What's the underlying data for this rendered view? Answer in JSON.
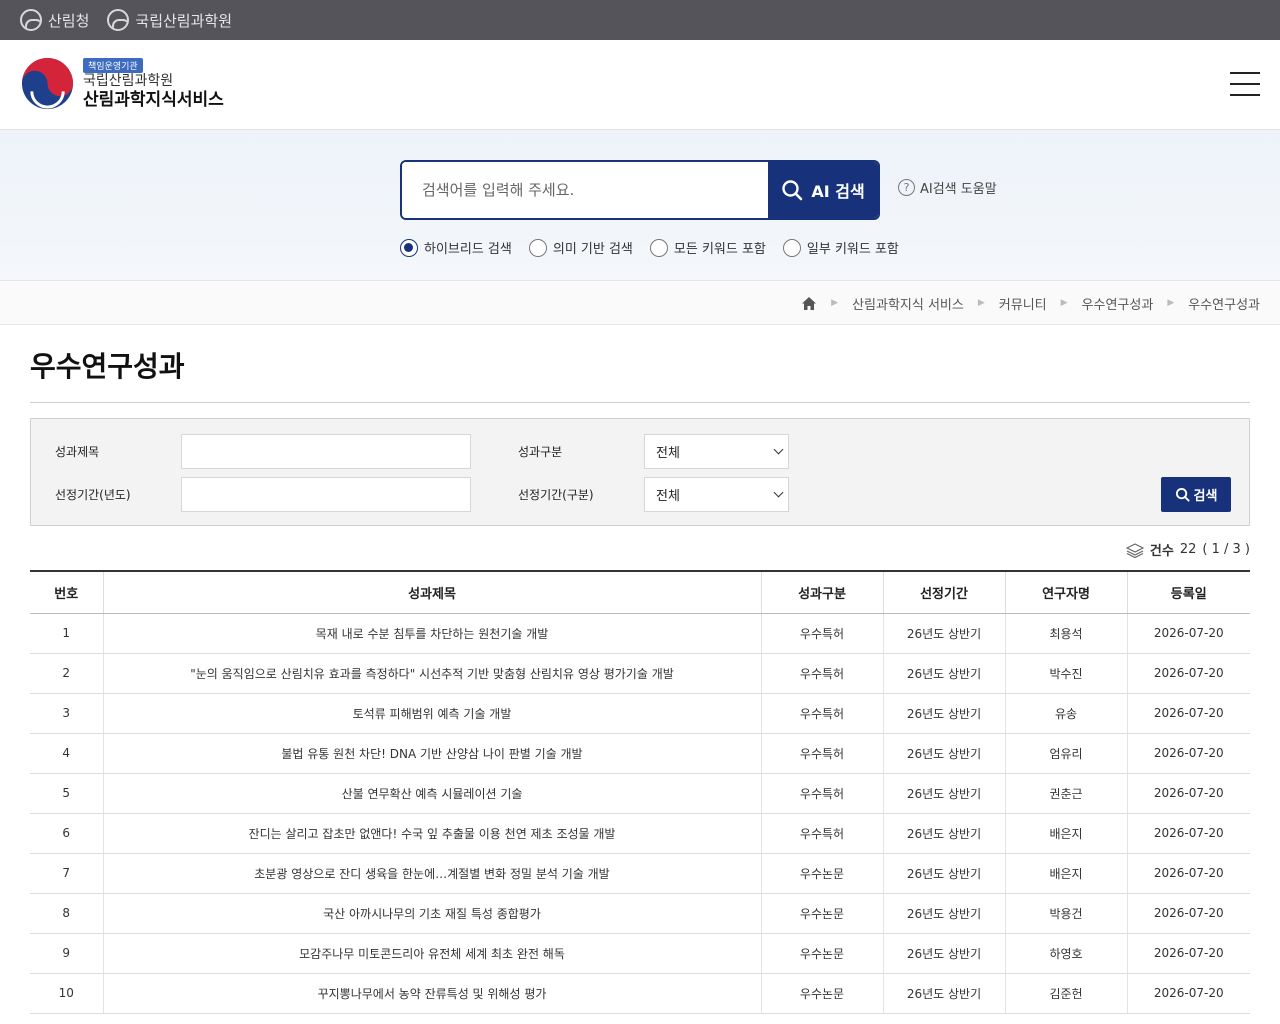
{
  "topbar": {
    "links": [
      "산림청",
      "국립산림과학원"
    ]
  },
  "header": {
    "badge": "책임운영기관",
    "org_sub": "국립산림과학원",
    "org_main": "산림과학지식서비스"
  },
  "search": {
    "placeholder": "검색어를 입력해 주세요.",
    "button_label": "AI 검색",
    "help_label": "AI검색 도움말",
    "modes": [
      "하이브리드 검색",
      "의미 기반 검색",
      "모든 키워드 포함",
      "일부 키워드 포함"
    ],
    "selected_mode": 0
  },
  "breadcrumb": [
    "산림과학지식 서비스",
    "커뮤니티",
    "우수연구성과",
    "우수연구성과"
  ],
  "page_title": "우수연구성과",
  "filter": {
    "title_label": "성과제목",
    "category_label": "성과구분",
    "category_value": "전체",
    "year_label": "선정기간(년도)",
    "period_label": "선정기간(구분)",
    "period_value": "전체",
    "search_button": "검색"
  },
  "count": {
    "label": "건수",
    "total": "22",
    "pages": "( 1 / 3 )"
  },
  "table": {
    "headers": [
      "번호",
      "성과제목",
      "성과구분",
      "선정기간",
      "연구자명",
      "등록일"
    ],
    "rows": [
      [
        "1",
        "목재 내로 수분 침투를 차단하는 원천기술 개발",
        "우수특허",
        "26년도 상반기",
        "최용석",
        "2026-07-20"
      ],
      [
        "2",
        "\"눈의 움직임으로 산림치유 효과를 측정하다\" 시선추적 기반 맞춤형 산림치유 영상 평가기술 개발",
        "우수특허",
        "26년도 상반기",
        "박수진",
        "2026-07-20"
      ],
      [
        "3",
        "토석류 피해범위 예측 기술 개발",
        "우수특허",
        "26년도 상반기",
        "유송",
        "2026-07-20"
      ],
      [
        "4",
        "불법 유통 원천 차단! DNA 기반 산양삼 나이 판별 기술 개발",
        "우수특허",
        "26년도 상반기",
        "엄유리",
        "2026-07-20"
      ],
      [
        "5",
        "산불 연무확산 예측 시뮬레이션 기술",
        "우수특허",
        "26년도 상반기",
        "권춘근",
        "2026-07-20"
      ],
      [
        "6",
        "잔디는 살리고 잡초만 없앤다! 수국 잎 추출물 이용 천연 제초 조성물 개발",
        "우수특허",
        "26년도 상반기",
        "배은지",
        "2026-07-20"
      ],
      [
        "7",
        "초분광 영상으로 잔디 생육을 한눈에…계절별 변화 정밀 분석 기술 개발",
        "우수논문",
        "26년도 상반기",
        "배은지",
        "2026-07-20"
      ],
      [
        "8",
        "국산 아까시나무의 기초 재질 특성 종합평가",
        "우수논문",
        "26년도 상반기",
        "박용건",
        "2026-07-20"
      ],
      [
        "9",
        "모감주나무 미토콘드리아 유전체 세계 최초 완전 해독",
        "우수논문",
        "26년도 상반기",
        "하영호",
        "2026-07-20"
      ],
      [
        "10",
        "꾸지뽕나무에서 농약 잔류특성 및 위해성 평가",
        "우수논문",
        "26년도 상반기",
        "김준헌",
        "2026-07-20"
      ]
    ]
  },
  "colors": {
    "primary": "#17327a",
    "topbar": "#54545a"
  }
}
